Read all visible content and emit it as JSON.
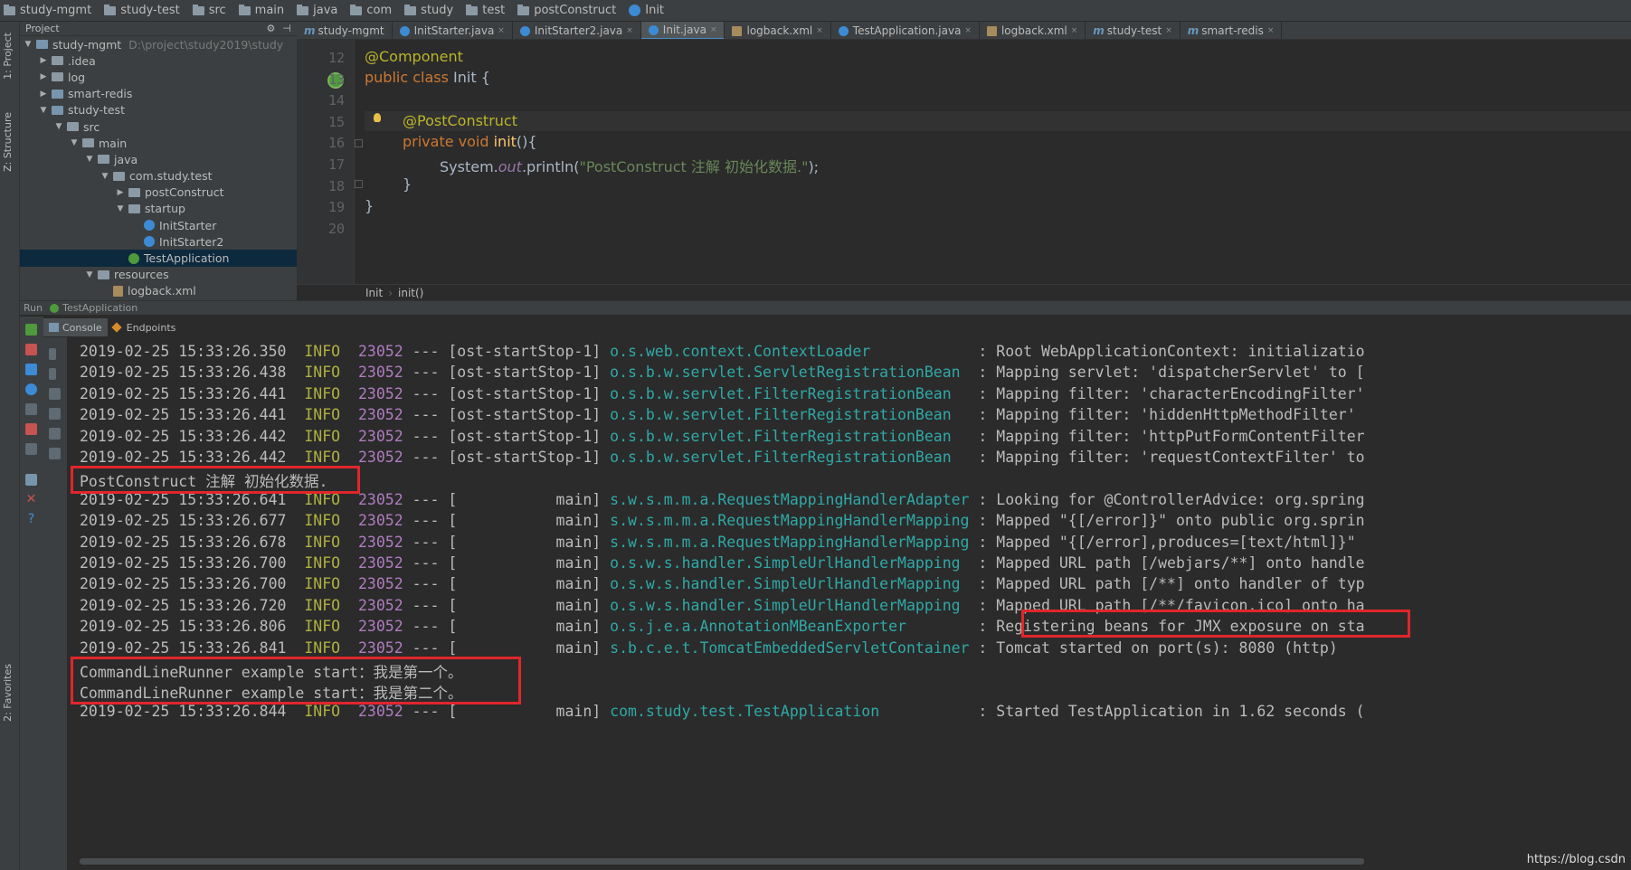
{
  "breadcrumb": [
    "study-mgmt",
    "study-test",
    "src",
    "main",
    "java",
    "com",
    "study",
    "test",
    "postConstruct",
    "Init"
  ],
  "left_strip": {
    "project_tab": "1: Project",
    "structure_tab": "Z: Structure",
    "favorites_tab": "2: Favorites"
  },
  "project_panel": {
    "header": "Project",
    "tree": [
      {
        "label": "study-mgmt",
        "hint": "D:\\project\\study2019\\study",
        "icon": "module",
        "arrow": "▼",
        "indent": 0
      },
      {
        "label": ".idea",
        "icon": "folder",
        "arrow": "▶",
        "indent": 1
      },
      {
        "label": "log",
        "icon": "folder",
        "arrow": "▶",
        "indent": 1
      },
      {
        "label": "smart-redis",
        "icon": "module",
        "arrow": "▶",
        "indent": 1
      },
      {
        "label": "study-test",
        "icon": "module",
        "arrow": "▼",
        "indent": 1
      },
      {
        "label": "src",
        "icon": "folder",
        "arrow": "▼",
        "indent": 2
      },
      {
        "label": "main",
        "icon": "folder",
        "arrow": "▼",
        "indent": 3
      },
      {
        "label": "java",
        "icon": "folder",
        "arrow": "▼",
        "indent": 4
      },
      {
        "label": "com.study.test",
        "icon": "folder",
        "arrow": "▼",
        "indent": 5
      },
      {
        "label": "postConstruct",
        "icon": "folder",
        "arrow": "▶",
        "indent": 6
      },
      {
        "label": "startup",
        "icon": "folder",
        "arrow": "▼",
        "indent": 6
      },
      {
        "label": "InitStarter",
        "icon": "class",
        "arrow": "",
        "indent": 7
      },
      {
        "label": "InitStarter2",
        "icon": "class",
        "arrow": "",
        "indent": 7
      },
      {
        "label": "TestApplication",
        "icon": "spring-class",
        "arrow": "",
        "indent": 6,
        "selected": true
      },
      {
        "label": "resources",
        "icon": "folder",
        "arrow": "▼",
        "indent": 4
      },
      {
        "label": "logback.xml",
        "icon": "xml",
        "arrow": "",
        "indent": 5
      }
    ]
  },
  "tabs": [
    {
      "label": "study-mgmt",
      "icon": "m"
    },
    {
      "label": "InitStarter.java",
      "icon": "class",
      "close": "×"
    },
    {
      "label": "InitStarter2.java",
      "icon": "class",
      "close": "×"
    },
    {
      "label": "Init.java",
      "icon": "class",
      "close": "×",
      "active": true
    },
    {
      "label": "logback.xml",
      "icon": "xml",
      "close": "×"
    },
    {
      "label": "TestApplication.java",
      "icon": "class",
      "close": "×"
    },
    {
      "label": "logback.xml",
      "icon": "xml",
      "close": "×"
    },
    {
      "label": "study-test",
      "icon": "m",
      "close": "×"
    },
    {
      "label": "smart-redis",
      "icon": "m",
      "close": "×"
    }
  ],
  "editor": {
    "line_numbers": [
      "12",
      "13",
      "14",
      "15",
      "16",
      "17",
      "18",
      "19",
      "20"
    ],
    "code": {
      "l12": "@Component",
      "l13_kw": "public class",
      "l13_name": " Init {",
      "l15": "@PostConstruct",
      "l16_kw": "private void",
      "l16_fn": "init",
      "l16_rest": "(){",
      "l17_a": "System.",
      "l17_out": "out",
      "l17_b": ".println(",
      "l17_str": "\"PostConstruct 注解 初始化数据.\"",
      "l17_c": ");",
      "l18": "}",
      "l19": "}"
    },
    "breadcrumb": [
      "Init",
      "init()"
    ],
    "breadcrumb_sep": "›"
  },
  "run": {
    "label": "Run",
    "config": "TestApplication",
    "subtabs": [
      "Console",
      "Endpoints"
    ]
  },
  "console": {
    "lines": [
      {
        "ts": "2019-02-25 15:33:26.350",
        "level": "INFO",
        "pid": "23052",
        "thread": " --- [ost-startStop-1] ",
        "logger": "o.s.web.context.ContextLoader           ",
        "msg": " : Root WebApplicationContext: initializatio"
      },
      {
        "ts": "2019-02-25 15:33:26.438",
        "level": "INFO",
        "pid": "23052",
        "thread": " --- [ost-startStop-1] ",
        "logger": "o.s.b.w.servlet.ServletRegistrationBean ",
        "msg": " : Mapping servlet: 'dispatcherServlet' to ["
      },
      {
        "ts": "2019-02-25 15:33:26.441",
        "level": "INFO",
        "pid": "23052",
        "thread": " --- [ost-startStop-1] ",
        "logger": "o.s.b.w.servlet.FilterRegistrationBean  ",
        "msg": " : Mapping filter: 'characterEncodingFilter'"
      },
      {
        "ts": "2019-02-25 15:33:26.441",
        "level": "INFO",
        "pid": "23052",
        "thread": " --- [ost-startStop-1] ",
        "logger": "o.s.b.w.servlet.FilterRegistrationBean  ",
        "msg": " : Mapping filter: 'hiddenHttpMethodFilter'"
      },
      {
        "ts": "2019-02-25 15:33:26.442",
        "level": "INFO",
        "pid": "23052",
        "thread": " --- [ost-startStop-1] ",
        "logger": "o.s.b.w.servlet.FilterRegistrationBean  ",
        "msg": " : Mapping filter: 'httpPutFormContentFilter"
      },
      {
        "ts": "2019-02-25 15:33:26.442",
        "level": "INFO",
        "pid": "23052",
        "thread": " --- [ost-startStop-1] ",
        "logger": "o.s.b.w.servlet.FilterRegistrationBean  ",
        "msg": " : Mapping filter: 'requestContextFilter' to"
      },
      {
        "plain": "PostConstruct 注解 初始化数据."
      },
      {
        "ts": "2019-02-25 15:33:26.641",
        "level": "INFO",
        "pid": "23052",
        "thread": " --- [           main] ",
        "logger": "s.w.s.m.m.a.RequestMappingHandlerAdapter",
        "msg": " : Looking for @ControllerAdvice: org.spring"
      },
      {
        "ts": "2019-02-25 15:33:26.677",
        "level": "INFO",
        "pid": "23052",
        "thread": " --- [           main] ",
        "logger": "s.w.s.m.m.a.RequestMappingHandlerMapping",
        "msg": " : Mapped \"{[/error]}\" onto public org.sprin"
      },
      {
        "ts": "2019-02-25 15:33:26.678",
        "level": "INFO",
        "pid": "23052",
        "thread": " --- [           main] ",
        "logger": "s.w.s.m.m.a.RequestMappingHandlerMapping",
        "msg": " : Mapped \"{[/error],produces=[text/html]}\" "
      },
      {
        "ts": "2019-02-25 15:33:26.700",
        "level": "INFO",
        "pid": "23052",
        "thread": " --- [           main] ",
        "logger": "o.s.w.s.handler.SimpleUrlHandlerMapping ",
        "msg": " : Mapped URL path [/webjars/**] onto handle"
      },
      {
        "ts": "2019-02-25 15:33:26.700",
        "level": "INFO",
        "pid": "23052",
        "thread": " --- [           main] ",
        "logger": "o.s.w.s.handler.SimpleUrlHandlerMapping ",
        "msg": " : Mapped URL path [/**] onto handler of typ"
      },
      {
        "ts": "2019-02-25 15:33:26.720",
        "level": "INFO",
        "pid": "23052",
        "thread": " --- [           main] ",
        "logger": "o.s.w.s.handler.SimpleUrlHandlerMapping ",
        "msg": " : Mapped URL path [/**/favicon.ico] onto ha"
      },
      {
        "ts": "2019-02-25 15:33:26.806",
        "level": "INFO",
        "pid": "23052",
        "thread": " --- [           main] ",
        "logger": "o.s.j.e.a.AnnotationMBeanExporter       ",
        "msg": " : Registering beans for JMX exposure on sta"
      },
      {
        "ts": "2019-02-25 15:33:26.841",
        "level": "INFO",
        "pid": "23052",
        "thread": " --- [           main] ",
        "logger": "s.b.c.e.t.TomcatEmbeddedServletContainer",
        "msg": " : Tomcat started on port(s): 8080 (http)"
      },
      {
        "plain": "CommandLineRunner example start：我是第一个。"
      },
      {
        "plain": "CommandLineRunner example start：我是第二个。"
      },
      {
        "ts": "2019-02-25 15:33:26.844",
        "level": "INFO",
        "pid": "23052",
        "thread": " --- [           main] ",
        "logger": "com.study.test.TestApplication          ",
        "msg": " : Started TestApplication in 1.62 seconds ("
      }
    ]
  },
  "watermark": "https://blog.csdn",
  "colors": {
    "highlight_box": "#e0262b",
    "accent": "#4a88c7"
  }
}
